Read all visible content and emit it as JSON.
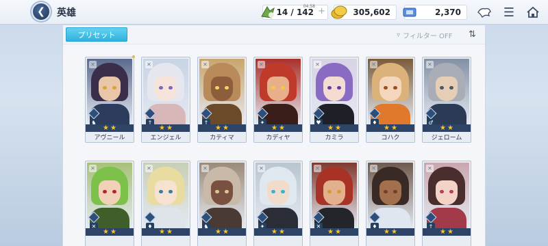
{
  "header": {
    "title": "英雄",
    "resources": {
      "stamina": {
        "value": "14 / 142",
        "timer": "04:58",
        "icon": "stamina-icon"
      },
      "gold": {
        "value": "305,602",
        "icon": "gold-coin-icon"
      },
      "tickets": {
        "value": "2,370",
        "icon": "ticket-icon"
      }
    },
    "icons": [
      "summon-icon",
      "menu-icon",
      "home-icon"
    ]
  },
  "toolbar": {
    "preset_label": "プリセット",
    "filter_label": "フィルター OFF"
  },
  "heroes": [
    {
      "name": "アヴニール",
      "stars": 2,
      "colors": {
        "hair": "#3a2e4a",
        "face": "#e9c6a8",
        "body": "#2d3b5c",
        "bg": "#5a6a8e",
        "eye": "#d4a63a"
      }
    },
    {
      "name": "エンジェル",
      "stars": 2,
      "colors": {
        "hair": "#e6e6ee",
        "face": "#f6e3da",
        "body": "#d8b7b9",
        "bg": "#c8d3e4",
        "eye": "#7a6bb8"
      }
    },
    {
      "name": "カティマ",
      "stars": 2,
      "colors": {
        "hair": "#b98b5a",
        "face": "#8e5d3c",
        "body": "#6b4a2a",
        "bg": "#c9a56e",
        "eye": "#f0d36a"
      }
    },
    {
      "name": "カディヤ",
      "stars": 2,
      "colors": {
        "hair": "#c03a2b",
        "face": "#e7b08a",
        "body": "#3a1e1a",
        "bg": "#a9302a",
        "eye": "#f3c84a"
      }
    },
    {
      "name": "カミラ",
      "stars": 2,
      "colors": {
        "hair": "#8a6bc4",
        "face": "#f5dcd2",
        "body": "#1f1f28",
        "bg": "#d7d3e4",
        "eye": "#6a3f9a"
      }
    },
    {
      "name": "コハク",
      "stars": 2,
      "colors": {
        "hair": "#dbb27a",
        "face": "#f3d6bc",
        "body": "#e0792b",
        "bg": "#7a5b3a",
        "eye": "#9a5020"
      }
    },
    {
      "name": "ジェローム",
      "stars": 2,
      "colors": {
        "hair": "#a8adb6",
        "face": "#e6cdb6",
        "body": "#2b3a55",
        "bg": "#8390a4",
        "eye": "#4e5866"
      }
    },
    {
      "name": "",
      "stars": 2,
      "colors": {
        "hair": "#7cc24a",
        "face": "#f1d2b8",
        "body": "#3f5e2a",
        "bg": "#a8c07a",
        "eye": "#b2243a"
      }
    },
    {
      "name": "",
      "stars": 2,
      "colors": {
        "hair": "#e9dca0",
        "face": "#f6e3cf",
        "body": "#dfe3ea",
        "bg": "#c7cfb6",
        "eye": "#3e7c9c"
      }
    },
    {
      "name": "",
      "stars": 2,
      "colors": {
        "hair": "#c9b9a8",
        "face": "#7a5040",
        "body": "#4a3a34",
        "bg": "#9a8a7a",
        "eye": "#d9c39a"
      }
    },
    {
      "name": "",
      "stars": 2,
      "colors": {
        "hair": "#dfe8ee",
        "face": "#f1dccb",
        "body": "#2a2c36",
        "bg": "#b9c5cf",
        "eye": "#3fb0c9"
      }
    },
    {
      "name": "",
      "stars": 2,
      "colors": {
        "hair": "#a83226",
        "face": "#e3b08e",
        "body": "#23252b",
        "bg": "#7e3a30",
        "eye": "#d19a3a"
      }
    },
    {
      "name": "",
      "stars": 2,
      "colors": {
        "hair": "#3a2a26",
        "face": "#a3704e",
        "body": "#dfe6ef",
        "bg": "#6e5a4e",
        "eye": "#7a3b2a"
      }
    },
    {
      "name": "",
      "stars": 2,
      "colors": {
        "hair": "#4a2e2e",
        "face": "#f2d3c6",
        "body": "#a23a4a",
        "bg": "#c9a6b0",
        "eye": "#b2435a"
      }
    }
  ]
}
